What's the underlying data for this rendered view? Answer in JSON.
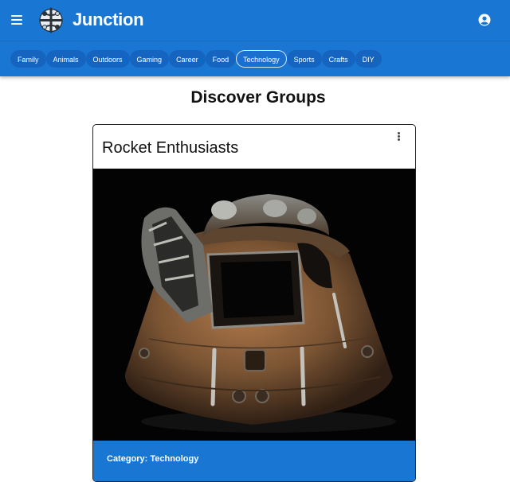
{
  "app": {
    "title": "Junction"
  },
  "categories": [
    "Family",
    "Animals",
    "Outdoors",
    "Gaming",
    "Career",
    "Food",
    "Technology",
    "Sports",
    "Crafts",
    "DIY"
  ],
  "active_category": "Technology",
  "page": {
    "title": "Discover Groups"
  },
  "group_card": {
    "title": "Rocket Enthusiasts",
    "category_text": "Category: Technology",
    "image_subject": "space capsule"
  },
  "colors": {
    "primary": "#1976d2",
    "chip": "#1565c0",
    "footer": "#1976d2"
  },
  "icons": {
    "menu": "menu-icon",
    "logo": "junction-logo",
    "account": "account-circle-icon",
    "more": "more-vertical-icon"
  }
}
